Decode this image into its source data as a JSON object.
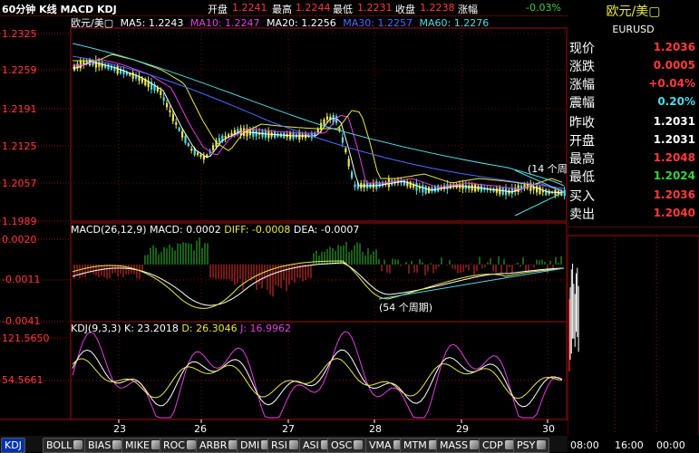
{
  "topbar": {
    "chart_title": "60分钟 K线 MACD KDJ",
    "open_label": "开盘",
    "open_value": "1.2241",
    "high_label": "最高",
    "high_value": "1.2244",
    "low_label": "最低",
    "low_value": "1.2231",
    "close_label": "收盘",
    "close_value": "1.2238",
    "change_label": "涨幅",
    "change_value": "-0.03%"
  },
  "main_panel": {
    "symbol": "欧元/美▢",
    "ma5": "MA5: 1.2243",
    "ma10": "MA10: 1.2247",
    "ma20": "MA20: 1.2256",
    "ma30": "MA30: 1.2257",
    "ma60": "MA60: 1.2276",
    "annotation": "(14 个周",
    "y_labels": [
      "1.2325",
      "1.2259",
      "1.2191",
      "1.2125",
      "1.2057",
      "1.1989"
    ]
  },
  "macd_panel": {
    "name": "MACD(26,12,9)",
    "macd": "MACD: 0.0002",
    "diff": "DIFF: -0.0008",
    "dea": "DEA: -0.0007",
    "annotation": "(54 个周期)",
    "y_labels": [
      "0.0020",
      "-0.0011",
      "-0.0041"
    ]
  },
  "kdj_panel": {
    "name": "KDJ(9,3,3)",
    "k": "K: 23.2018",
    "d": "D: 26.3046",
    "j": "J: 16.9962",
    "y_labels": [
      "121.5650",
      "54.5661"
    ]
  },
  "x_axis": [
    "23",
    "26",
    "27",
    "28",
    "29",
    "30"
  ],
  "tabs": [
    "KDJ",
    "BOLL",
    "BIAS",
    "MIKE",
    "ROC",
    "ARBR",
    "DMI",
    "RSI",
    "ASI",
    "OSC",
    "VMA",
    "MTM",
    "MASS",
    "CDP",
    "PSY"
  ],
  "active_tab": "KDJ",
  "quote": {
    "title": "欧元/美▢",
    "symbol": "EURUSD",
    "rows": [
      {
        "label": "现价",
        "value": "1.2036",
        "color": "#ff3a3a"
      },
      {
        "label": "涨跌",
        "value": "0.0005",
        "color": "#ff3a3a"
      },
      {
        "label": "涨幅",
        "value": "+0.04%",
        "color": "#ff3a3a"
      },
      {
        "label": "震幅",
        "value": "0.20%",
        "color": "#4fd9e6"
      },
      {
        "label": "昨收",
        "value": "1.2031",
        "color": "#ffffff"
      },
      {
        "label": "开盘",
        "value": "1.2031",
        "color": "#ffffff"
      },
      {
        "label": "最高",
        "value": "1.2048",
        "color": "#ff3a3a"
      },
      {
        "label": "最低",
        "value": "1.2024",
        "color": "#3ad13a"
      },
      {
        "label": "买入",
        "value": "1.2036",
        "color": "#ff3a3a"
      },
      {
        "label": "卖出",
        "value": "1.2040",
        "color": "#ff3a3a"
      }
    ]
  },
  "tick_times": [
    "08:00",
    "16:00",
    "00:00"
  ],
  "colors": {
    "grid_red": "#a01010",
    "up": "#4fd9e6",
    "down": "#e8e84a",
    "bull": "#e83030",
    "bear": "#30c030"
  }
}
